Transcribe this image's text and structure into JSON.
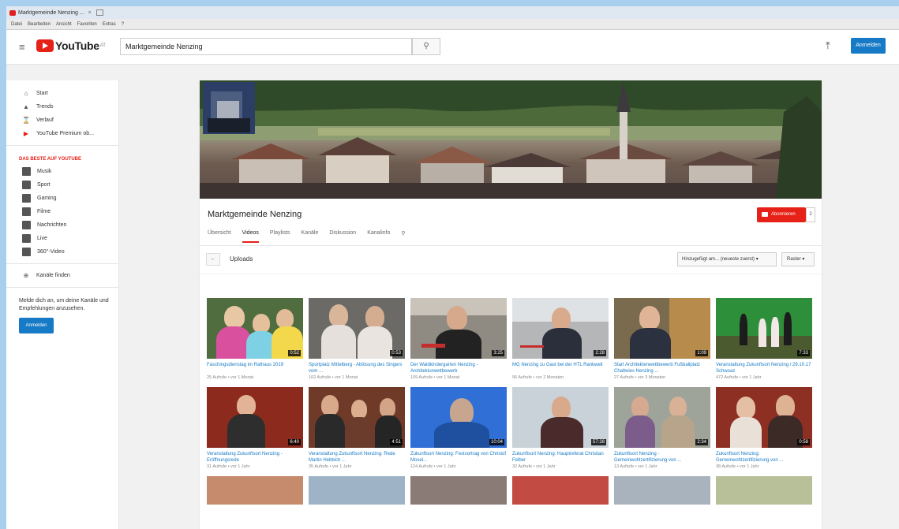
{
  "browser": {
    "tab_title": "Marktgemeinde Nenzing ...",
    "menu": [
      "Datei",
      "Bearbeiten",
      "Ansicht",
      "Favoriten",
      "Extras",
      "?"
    ]
  },
  "masthead": {
    "logo_text": "YouTube",
    "logo_sup": "AT",
    "search_value": "Marktgemeinde Nenzing",
    "signin_label": "Anmelden"
  },
  "guide": {
    "main_items": [
      {
        "label": "Start",
        "icon": "home-icon"
      },
      {
        "label": "Trends",
        "icon": "flame-icon"
      },
      {
        "label": "Verlauf",
        "icon": "history-icon"
      },
      {
        "label": "YouTube Premium ob...",
        "icon": "youtube-icon"
      }
    ],
    "section_heading": "DAS BESTE AUF YOUTUBE",
    "best_items": [
      "Musik",
      "Sport",
      "Gaming",
      "Filme",
      "Nachrichten",
      "Live",
      "360°-Video"
    ],
    "browse_channels": "Kanäle finden",
    "signin_message": "Melde dich an, um deine Kanäle und Empfehlungen anzusehen.",
    "signin_label": "Anmelden"
  },
  "channel": {
    "title": "Marktgemeinde Nenzing",
    "subscribe_label": "Abonnieren",
    "subscriber_count": "2",
    "tabs": [
      "Übersicht",
      "Videos",
      "Playlists",
      "Kanäle",
      "Diskussion",
      "Kanalinfo"
    ],
    "active_tab": 1,
    "uploads_label": "Uploads",
    "sort_label": "Hinzugefügt am... (neueste zuerst)",
    "view_label": "Raster"
  },
  "colors": {
    "youtube_red": "#e62117",
    "link_blue": "#167ac6"
  },
  "videos": [
    [
      {
        "title": "Faschingsdienstag im Rathaus 2019",
        "meta": "25 Aufrufe • vor 1 Monat",
        "duration": "0:52"
      },
      {
        "title": "Sportplatz Mittelberg - Ablösung des Singers vom ...",
        "meta": "102 Aufrufe • vor 1 Monat",
        "duration": "0:53"
      },
      {
        "title": "Der Waldkindergarten Nenzing - Architekturwettbewerb",
        "meta": "109 Aufrufe • vor 1 Monat",
        "duration": "3:25"
      },
      {
        "title": "MG Nenzing zu Gast bei der HTL Rankweil",
        "meta": "96 Aufrufe • vor 2 Monaten",
        "duration": "2:28"
      },
      {
        "title": "Start Architektenwettbewerb Fußballplatz Chaltwies Nenzing ...",
        "meta": "27 Aufrufe • vor 3 Monaten",
        "duration": "1:09"
      },
      {
        "title": "Veranstaltung Zukunftsort Nenzing / 29.10.17 Schwoaz",
        "meta": "472 Aufrufe • vor 1 Jahr",
        "duration": "7:33"
      }
    ],
    [
      {
        "title": "Veranstaltung Zukunftsort Nenzing - Eröffnungsrede",
        "meta": "31 Aufrufe • vor 1 Jahr",
        "duration": "6:40"
      },
      {
        "title": "Veranstaltung Zukunftsort Nenzing: Rede Martin Hebbich ...",
        "meta": "35 Aufrufe • vor 1 Jahr",
        "duration": "4:51"
      },
      {
        "title": "Zukunftsort Nenzing: Festvortrag von Christof Mosel...",
        "meta": "124 Aufrufe • vor 1 Jahr",
        "duration": "10:04"
      },
      {
        "title": "Zukunftsort Nenzing: Hauptreferat Christian Felber",
        "meta": "32 Aufrufe • vor 1 Jahr",
        "duration": "57:28"
      },
      {
        "title": "Zukunftsort Nenzing - Gemeinwohlzertifizierung von ...",
        "meta": "13 Aufrufe • vor 1 Jahr",
        "duration": "2:34"
      },
      {
        "title": "Zukunftsort Nenzing: Gemeinwohlzertifizierung von ...",
        "meta": "38 Aufrufe • vor 1 Jahr",
        "duration": "0:58"
      }
    ]
  ]
}
